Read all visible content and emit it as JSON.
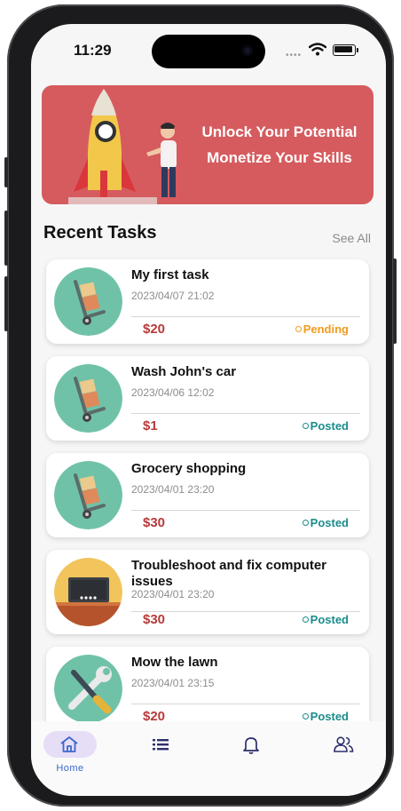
{
  "status_bar": {
    "time": "11:29"
  },
  "banner": {
    "line1": "Unlock Your Potential",
    "line2": "Monetize Your Skills"
  },
  "recent_tasks": {
    "title": "Recent Tasks",
    "see_all": "See All",
    "items": [
      {
        "title": "My first task",
        "date": "2023/04/07 21:02",
        "price": "$20",
        "status": "Pending",
        "image": "hand-truck-icon"
      },
      {
        "title": "Wash John's car",
        "date": "2023/04/06 12:02",
        "price": "$1",
        "status": "Posted",
        "image": "hand-truck-icon"
      },
      {
        "title": "Grocery shopping",
        "date": "2023/04/01 23:20",
        "price": "$30",
        "status": "Posted",
        "image": "hand-truck-icon"
      },
      {
        "title": "Troubleshoot and fix computer issues",
        "date": "2023/04/01 23:20",
        "price": "$30",
        "status": "Posted",
        "image": "monitor-desk-icon"
      },
      {
        "title": "Mow the lawn",
        "date": "2023/04/01 23:15",
        "price": "$20",
        "status": "Posted",
        "image": "wrench-screwdriver-icon"
      }
    ]
  },
  "bottom_nav": {
    "items": [
      {
        "label": "Home",
        "icon": "home-icon",
        "active": true
      },
      {
        "label": "",
        "icon": "list-icon"
      },
      {
        "label": "",
        "icon": "bell-icon"
      },
      {
        "label": "",
        "icon": "users-icon"
      }
    ]
  },
  "colors": {
    "banner": "#d65b5e",
    "price": "#b73a3a",
    "pending": "#f29b1e",
    "posted": "#1a8c8c",
    "nav_active_bg": "#e6ddf7",
    "thumb_bg": "#6fc2a8"
  }
}
